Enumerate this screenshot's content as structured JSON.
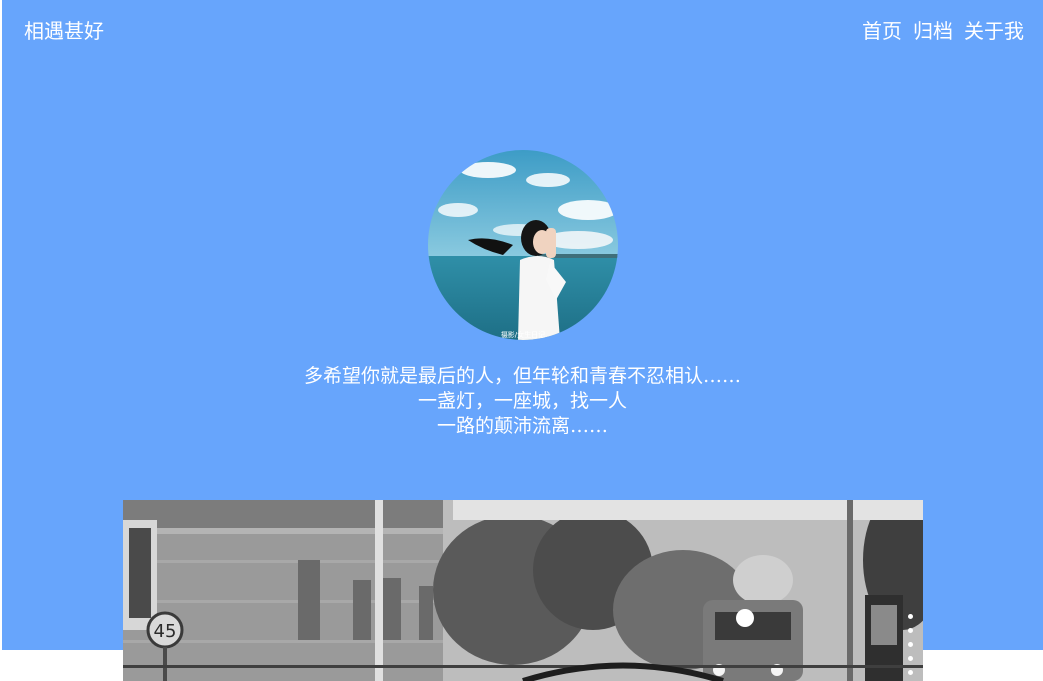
{
  "header": {
    "site_title": "相遇甚好",
    "nav": [
      {
        "label": "首页"
      },
      {
        "label": "归档"
      },
      {
        "label": "关于我"
      }
    ]
  },
  "hero": {
    "bio_lines": [
      "多希望你就是最后的人，但年轮和青春不忍相认……",
      "一盏灯，一座城，找一人",
      "一路的颠沛流离……"
    ],
    "avatar_watermark": "摄影/女生日记"
  },
  "colors": {
    "hero_background": "#67a5fc",
    "text": "#ffffff"
  },
  "cover": {
    "sign_number": "45"
  }
}
